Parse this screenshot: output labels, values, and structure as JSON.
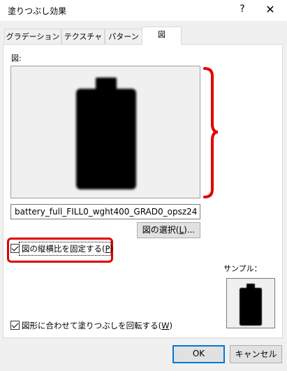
{
  "window": {
    "title": "塗りつぶし効果",
    "help_glyph": "?",
    "close_glyph": "✕"
  },
  "tabs": [
    {
      "label": "グラデーション",
      "active": false
    },
    {
      "label": "テクスチャ",
      "active": false
    },
    {
      "label": "パターン",
      "active": false
    },
    {
      "label": "図",
      "active": true
    }
  ],
  "picture_panel": {
    "section_label": "図:",
    "preview_icon": "battery-full-icon",
    "filename": "battery_full_FILL0_wght400_GRAD0_opsz24",
    "select_picture_label": "図の選択(",
    "select_picture_key": "L",
    "select_picture_suffix": ")...",
    "lock_aspect": {
      "label": "図の縦横比を固定する(",
      "key": "P",
      "suffix": ")",
      "checked": true
    },
    "rotate_with_shape": {
      "label": "図形に合わせて塗りつぶしを回転する(",
      "key": "W",
      "suffix": ")",
      "checked": true
    }
  },
  "sample": {
    "label": "サンプル：",
    "icon": "battery-full-icon"
  },
  "buttons": {
    "ok": "OK",
    "cancel": "キャンセル"
  },
  "annotation_color": "#e00000"
}
